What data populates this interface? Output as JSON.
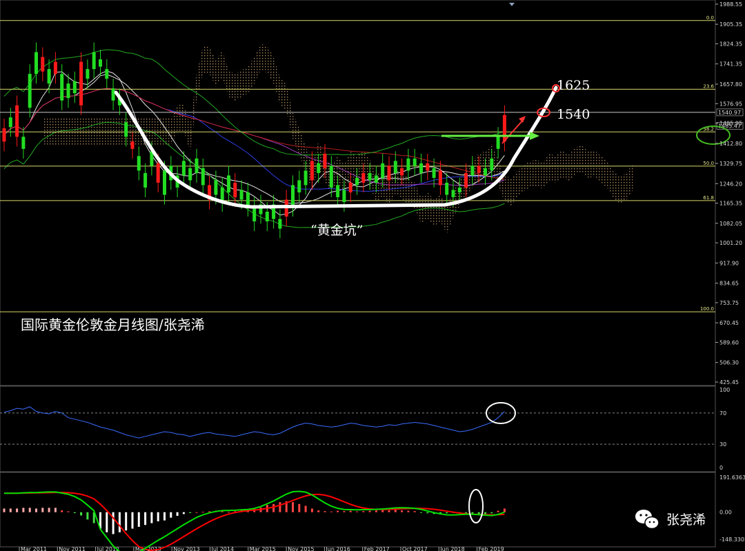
{
  "chart_data": [
    {
      "type": "candlestick",
      "title": "国际黄金伦敦金月线图/张尧浠",
      "y_ticks": [
        "1988.55",
        "1905.35",
        "1824.35",
        "1741.35",
        "1657.80",
        "1576.95",
        "1495.95",
        "1412.80",
        "1329.75",
        "1246.20",
        "1165.35",
        "1082.05",
        "1001.20",
        "917.90",
        "834.65",
        "753.75",
        "670.45",
        "589.60",
        "506.30",
        "425.45"
      ],
      "y_tick_values": [
        1988.55,
        1905.35,
        1824.35,
        1741.35,
        1657.8,
        1576.95,
        1495.95,
        1412.8,
        1329.75,
        1246.2,
        1165.35,
        1082.05,
        1001.2,
        917.9,
        834.65,
        753.75,
        670.45,
        589.6,
        506.3,
        425.45
      ],
      "ylim": [
        425.45,
        1995
      ],
      "x_ticks": [
        "Mar 2011",
        "Nov 2011",
        "Jul 2012",
        "Mar 2013",
        "Nov 2013",
        "Jul 2014",
        "Mar 2015",
        "Nov 2015",
        "Jun 2016",
        "Feb 2017",
        "Oct 2017",
        "Jun 2018",
        "Feb 2019"
      ],
      "fib_levels": [
        {
          "label": "0.0",
          "value": 1920.8
        },
        {
          "label": "23.6",
          "value": 1636.8
        },
        {
          "label": "38.2",
          "value": 1460
        },
        {
          "label": "50.0",
          "value": 1318.5
        },
        {
          "label": "61.8",
          "value": 1176
        },
        {
          "label": "100.0",
          "value": 716
        }
      ],
      "price_tags": [
        {
          "label": "1540.97",
          "value": 1540.97
        },
        {
          "label": "1485.47",
          "value": 1485.47
        }
      ],
      "candles": [
        [
          1420,
          1475
        ],
        [
          1480,
          1520
        ],
        [
          1440,
          1570
        ],
        [
          1390,
          1440
        ],
        [
          1560,
          1700
        ],
        [
          1700,
          1790
        ],
        [
          1710,
          1770
        ],
        [
          1660,
          1720
        ],
        [
          1700,
          1750
        ],
        [
          1590,
          1700
        ],
        [
          1600,
          1660
        ],
        [
          1620,
          1670
        ],
        [
          1570,
          1750
        ],
        [
          1680,
          1720
        ],
        [
          1720,
          1790
        ],
        [
          1730,
          1760
        ],
        [
          1680,
          1720
        ],
        [
          1590,
          1640
        ],
        [
          1570,
          1600
        ],
        [
          1440,
          1500
        ],
        [
          1390,
          1420
        ],
        [
          1300,
          1360
        ],
        [
          1230,
          1290
        ],
        [
          1320,
          1380
        ],
        [
          1250,
          1330
        ],
        [
          1200,
          1300
        ],
        [
          1260,
          1320
        ],
        [
          1230,
          1280
        ],
        [
          1280,
          1340
        ],
        [
          1260,
          1310
        ],
        [
          1290,
          1350
        ],
        [
          1240,
          1310
        ],
        [
          1180,
          1240
        ],
        [
          1200,
          1260
        ],
        [
          1170,
          1230
        ],
        [
          1210,
          1280
        ],
        [
          1190,
          1250
        ],
        [
          1180,
          1220
        ],
        [
          1150,
          1210
        ],
        [
          1090,
          1150
        ],
        [
          1120,
          1160
        ],
        [
          1090,
          1130
        ],
        [
          1100,
          1160
        ],
        [
          1060,
          1100
        ],
        [
          1110,
          1180
        ],
        [
          1150,
          1240
        ],
        [
          1210,
          1260
        ],
        [
          1240,
          1300
        ],
        [
          1260,
          1340
        ],
        [
          1290,
          1330
        ],
        [
          1310,
          1370
        ],
        [
          1230,
          1320
        ],
        [
          1190,
          1240
        ],
        [
          1170,
          1220
        ],
        [
          1210,
          1250
        ],
        [
          1240,
          1270
        ],
        [
          1250,
          1290
        ],
        [
          1260,
          1290
        ],
        [
          1250,
          1280
        ],
        [
          1270,
          1330
        ],
        [
          1260,
          1320
        ],
        [
          1290,
          1340
        ],
        [
          1280,
          1310
        ],
        [
          1300,
          1350
        ],
        [
          1320,
          1350
        ],
        [
          1290,
          1330
        ],
        [
          1300,
          1330
        ],
        [
          1270,
          1310
        ],
        [
          1240,
          1300
        ],
        [
          1200,
          1250
        ],
        [
          1190,
          1220
        ],
        [
          1210,
          1230
        ],
        [
          1230,
          1290
        ],
        [
          1280,
          1320
        ],
        [
          1290,
          1320
        ],
        [
          1280,
          1310
        ],
        [
          1300,
          1350
        ],
        [
          1390,
          1440
        ],
        [
          1420,
          1530
        ]
      ],
      "bowl_annotation": "“黄金坑”",
      "targets": [
        {
          "label": "1625",
          "value": 1625
        },
        {
          "label": "1540",
          "value": 1540
        }
      ]
    },
    {
      "type": "line",
      "series": [
        {
          "values": [
            71,
            73,
            76,
            75,
            78,
            72,
            70,
            69,
            72,
            70,
            64,
            62,
            60,
            58,
            55,
            52,
            50,
            48,
            45,
            42,
            40,
            38,
            40,
            42,
            44,
            46,
            45,
            43,
            42,
            40,
            42,
            44,
            45,
            43,
            42,
            41,
            40,
            42,
            44,
            46,
            45,
            43,
            42,
            44,
            48,
            52,
            55,
            57,
            56,
            54,
            53,
            52,
            53,
            55,
            57,
            56,
            54,
            53,
            52,
            53,
            55,
            54,
            56,
            57,
            58,
            57,
            56,
            54,
            52,
            50,
            48,
            46,
            47,
            49,
            52,
            55,
            58,
            64,
            72
          ]
        }
      ],
      "ylim": [
        0,
        100
      ],
      "y_ticks": [
        "100",
        "70",
        "30",
        "0"
      ],
      "y_tick_values": [
        100,
        70,
        30,
        0
      ]
    },
    {
      "type": "bar",
      "y_ticks": [
        "191.6363",
        "0.00",
        "-148.3305"
      ],
      "y_tick_values": [
        191.6363,
        0,
        -148.3305
      ],
      "ylim": [
        -148.3305,
        191.6363
      ],
      "histogram": [
        20,
        20,
        20,
        24,
        24,
        20,
        24,
        24,
        24,
        10,
        5,
        -5,
        -18,
        -40,
        -60,
        -90,
        -110,
        -120,
        -110,
        -100,
        -90,
        -80,
        -70,
        -60,
        -50,
        -45,
        -30,
        -20,
        -10,
        -5,
        0,
        2,
        5,
        8,
        5,
        2,
        5,
        10,
        12,
        18,
        25,
        40,
        45,
        55,
        60,
        55,
        45,
        35,
        20,
        10,
        6,
        4,
        8,
        6,
        8,
        4,
        6,
        8,
        10,
        12,
        10,
        14,
        10,
        8,
        6,
        -3,
        -6,
        -10,
        -8,
        -6,
        -4,
        -2,
        -6,
        -8,
        -10,
        -12,
        -6,
        8,
        20
      ]
    }
  ],
  "caption": "国际黄金伦敦金月线图/张尧浠",
  "brand": {
    "name": "张尧浠",
    "icon": "wechat-icon"
  },
  "colors": {
    "bull": "#ff1a1a",
    "bear": "#22dd22",
    "fib": "#d8d86a",
    "rsi": "#3a6cff",
    "macd_fast": "#00e000",
    "macd_slow": "#ff0000",
    "bowl": "#ffffff"
  }
}
